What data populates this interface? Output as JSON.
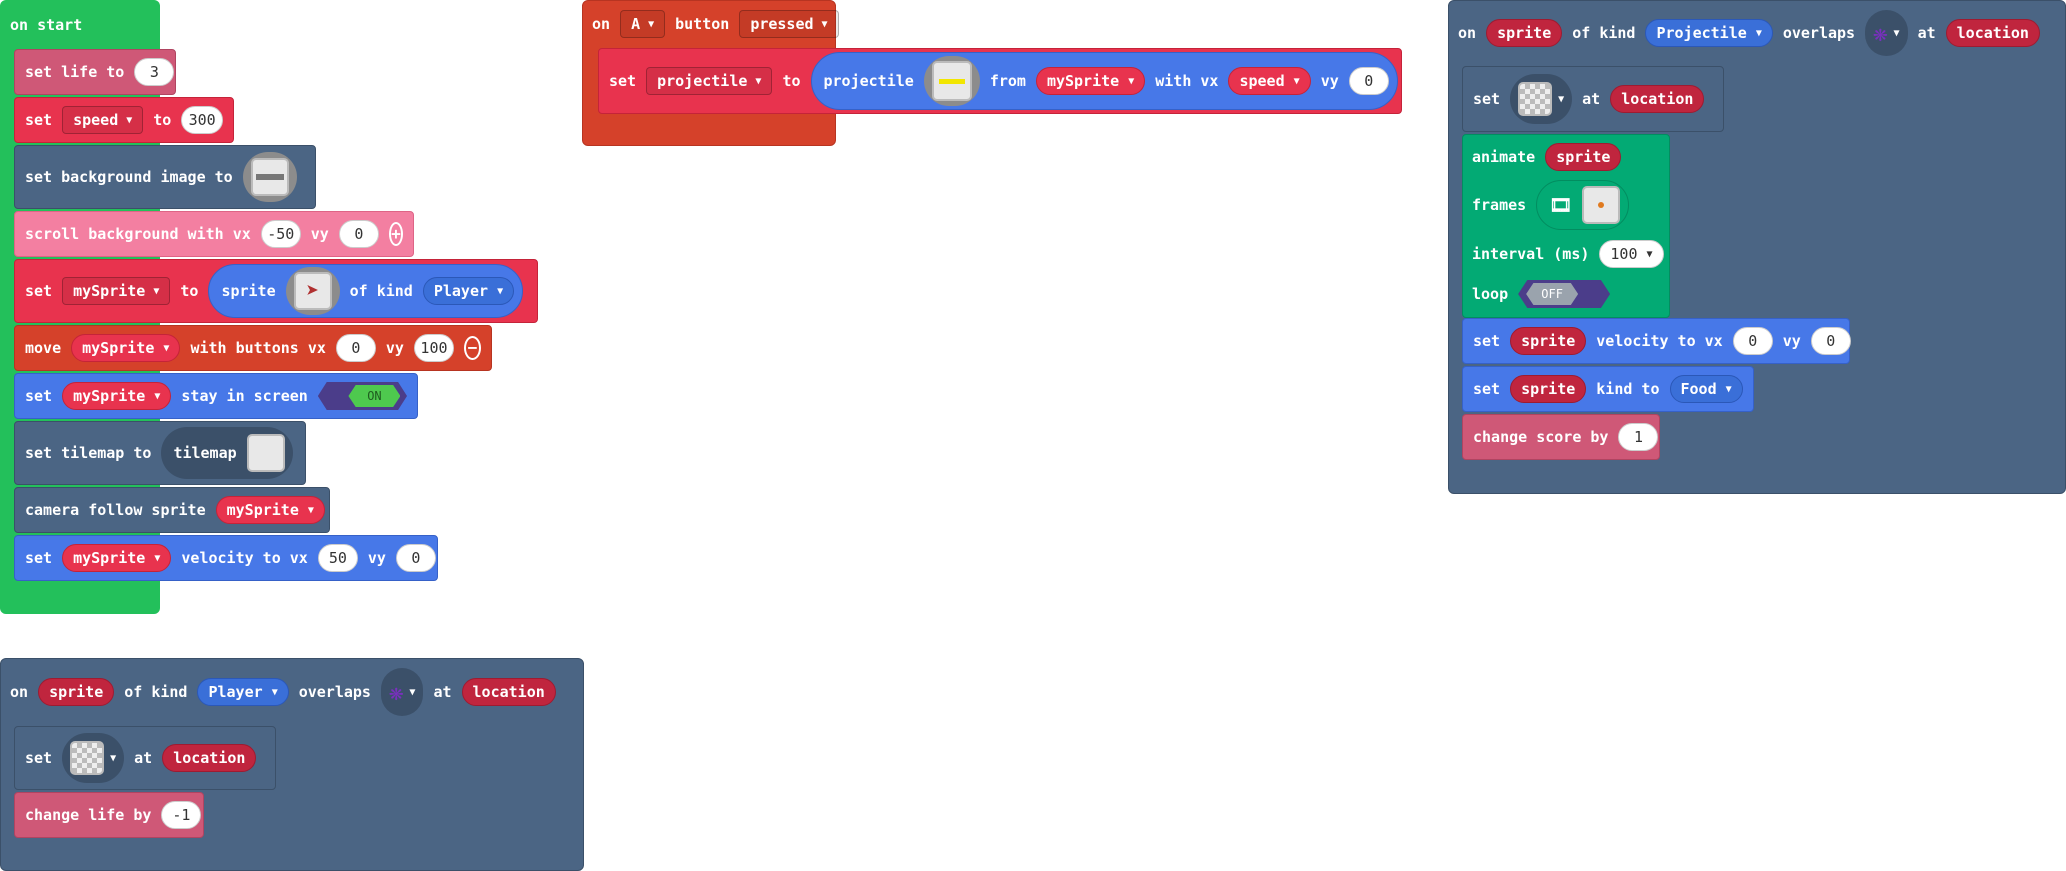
{
  "on_start": {
    "header": "on start",
    "set_life": {
      "prefix": "set life to",
      "value": "3"
    },
    "set_speed": {
      "set": "set",
      "var": "speed",
      "to": "to",
      "value": "300"
    },
    "set_bg": {
      "label": "set background image to"
    },
    "scroll_bg": {
      "prefix": "scroll background with vx",
      "vx": "-50",
      "vy_label": "vy",
      "vy": "0"
    },
    "set_mysprite": {
      "set": "set",
      "var": "mySprite",
      "to": "to",
      "sprite": "sprite",
      "of_kind": "of kind",
      "kind": "Player"
    },
    "move": {
      "move": "move",
      "var": "mySprite",
      "label": "with buttons vx",
      "vx": "0",
      "vy_label": "vy",
      "vy": "100"
    },
    "stay": {
      "set": "set",
      "var": "mySprite",
      "label": "stay in screen",
      "toggle": "ON"
    },
    "tilemap": {
      "label": "set tilemap to",
      "reporter": "tilemap"
    },
    "camera": {
      "label": "camera follow sprite",
      "var": "mySprite"
    },
    "velocity": {
      "set": "set",
      "var": "mySprite",
      "label": "velocity to vx",
      "vx": "50",
      "vy_label": "vy",
      "vy": "0"
    }
  },
  "on_button": {
    "on": "on",
    "button_key": "A",
    "button": "button",
    "state": "pressed",
    "set": "set",
    "var": "projectile",
    "to": "to",
    "reporter": "projectile",
    "from": "from",
    "src": "mySprite",
    "with_vx": "with vx",
    "vx": "speed",
    "vy_label": "vy",
    "vy": "0"
  },
  "overlap_projectile": {
    "on": "on",
    "sprite": "sprite",
    "of_kind": "of kind",
    "kind": "Projectile",
    "overlaps": "overlaps",
    "at": "at",
    "location": "location",
    "set_tile": {
      "set": "set",
      "at": "at",
      "location": "location"
    },
    "animate": {
      "label": "animate",
      "sprite": "sprite",
      "frames": "frames",
      "interval_label": "interval (ms)",
      "interval": "100",
      "loop": "loop",
      "loop_val": "OFF"
    },
    "set_vel": {
      "set": "set",
      "sprite": "sprite",
      "label": "velocity to vx",
      "vx": "0",
      "vy_label": "vy",
      "vy": "0"
    },
    "set_kind": {
      "set": "set",
      "sprite": "sprite",
      "label": "kind to",
      "kind": "Food"
    },
    "score": {
      "label": "change score by",
      "value": "1"
    }
  },
  "overlap_player": {
    "on": "on",
    "sprite": "sprite",
    "of_kind": "of kind",
    "kind": "Player",
    "overlaps": "overlaps",
    "at": "at",
    "location": "location",
    "set_tile": {
      "set": "set",
      "at": "at",
      "location": "location"
    },
    "life": {
      "label": "change life by",
      "value": "-1"
    }
  },
  "colors": {
    "event": "#23c05b",
    "variables": "#e8334e",
    "scene": "#4b6584",
    "sprites": "#4778e8",
    "controller": "#d5412a",
    "info": "#cf5877",
    "animation": "#03aa74"
  },
  "icons": [
    "plus-icon",
    "minus-icon",
    "dropdown-caret-icon",
    "film-icon",
    "sprite-image",
    "tile-image"
  ]
}
